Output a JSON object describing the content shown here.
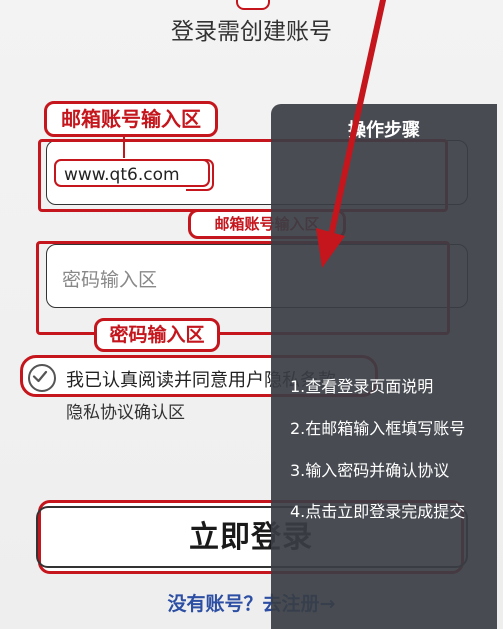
{
  "header": {
    "title": "登录需创建账号"
  },
  "email_section": {
    "label": "邮箱账号输入区",
    "label_secondary": "邮箱账号输入区",
    "value": "www.qt6.com"
  },
  "password_section": {
    "placeholder": "密码输入区",
    "label": "密码输入区"
  },
  "agreement": {
    "text": "我已认真阅读并同意用户隐私条款",
    "caption": "隐私协议确认区",
    "checked": true
  },
  "login_button": {
    "label": "立即登录"
  },
  "register_link": {
    "label": "没有账号？去注册→"
  },
  "steps_panel": {
    "title": "操作步骤",
    "steps": [
      "1.查看登录页面说明",
      "2.在邮箱输入框填写账号",
      "3.输入密码并确认协议",
      "4.点击立即登录完成提交"
    ]
  },
  "colors": {
    "highlight": "#c4161c",
    "panel": "#3a3e44",
    "link": "#2c4ea3"
  },
  "icons": {
    "checkbox": "check-circle-icon",
    "annotation_arrow": "arrow-down-icon"
  }
}
